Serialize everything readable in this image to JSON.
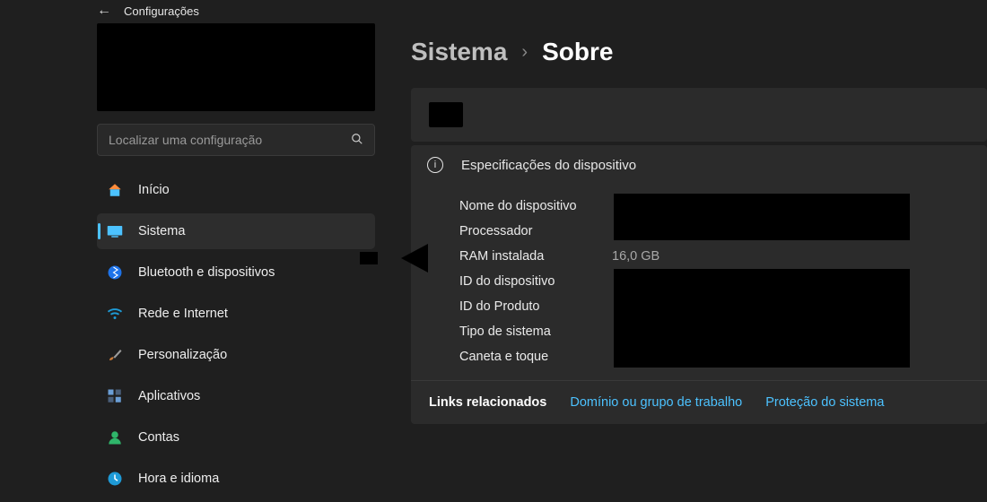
{
  "header": {
    "title": "Configurações"
  },
  "search": {
    "placeholder": "Localizar uma configuração"
  },
  "sidebar": {
    "items": [
      {
        "label": "Início"
      },
      {
        "label": "Sistema"
      },
      {
        "label": "Bluetooth e dispositivos"
      },
      {
        "label": "Rede e Internet"
      },
      {
        "label": "Personalização"
      },
      {
        "label": "Aplicativos"
      },
      {
        "label": "Contas"
      },
      {
        "label": "Hora e idioma"
      }
    ],
    "selected_index": 1
  },
  "breadcrumb": {
    "parent": "Sistema",
    "child": "Sobre"
  },
  "specs": {
    "header": "Especificações do dispositivo",
    "rows": [
      {
        "label": "Nome do dispositivo",
        "value": ""
      },
      {
        "label": "Processador",
        "value": ""
      },
      {
        "label": "RAM instalada",
        "value": "16,0 GB"
      },
      {
        "label": "ID do dispositivo",
        "value": ""
      },
      {
        "label": "ID do Produto",
        "value": ""
      },
      {
        "label": "Tipo de sistema",
        "value": ""
      },
      {
        "label": "Caneta e toque",
        "value": ""
      }
    ]
  },
  "links": {
    "title": "Links relacionados",
    "items": [
      {
        "label": "Domínio ou grupo de trabalho"
      },
      {
        "label": "Proteção do sistema"
      }
    ]
  }
}
